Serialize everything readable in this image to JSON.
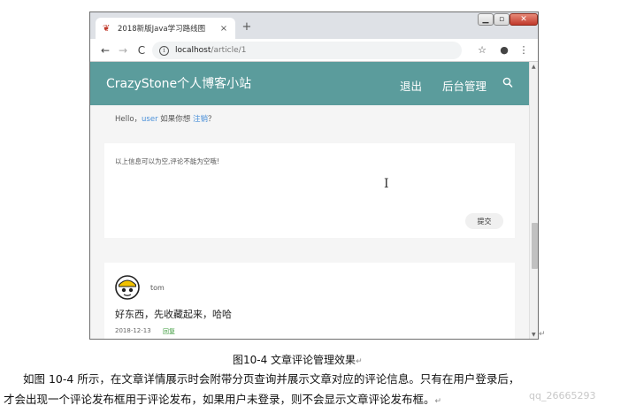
{
  "browser": {
    "tab_title": "2018新版Java学习路线图",
    "tab_close": "×",
    "new_tab": "+",
    "window_controls": {
      "minimize": "▁",
      "maximize": "▫",
      "close": "✕"
    },
    "url_host": "localhost",
    "url_path": "/article/1",
    "back": "←",
    "forward": "→",
    "reload": "C",
    "bookmark": "☆",
    "account": "●",
    "menu": "⋮"
  },
  "site": {
    "brand": "CrazyStone个人博客小站",
    "nav": {
      "logout": "退出",
      "admin": "后台管理"
    },
    "header_color": "#5b9c9c"
  },
  "greeting": {
    "prefix": "Hello，",
    "user": "user",
    "middle": " 如果你想 ",
    "logout_link": "注销",
    "suffix": "？"
  },
  "comment_form": {
    "hint": "以上信息可以为空,评论不能为空哦!",
    "submit_label": "提交"
  },
  "comment": {
    "author": "tom",
    "text": "好东西，先收藏起来，哈哈",
    "date": "2018-12-13",
    "reply_label": "回复"
  },
  "document": {
    "caption": "图10-4    文章评论管理效果",
    "paragraph_line1": "如图 10-4 所示，在文章详情展示时会附带分页查询并展示文章对应的评论信息。只有在用户登录后，",
    "paragraph_line2": "才会出现一个评论发布框用于评论发布，如果用户未登录，则不会显示文章评论发布框。",
    "return_mark": "↵",
    "watermark": "qq_26665293"
  }
}
